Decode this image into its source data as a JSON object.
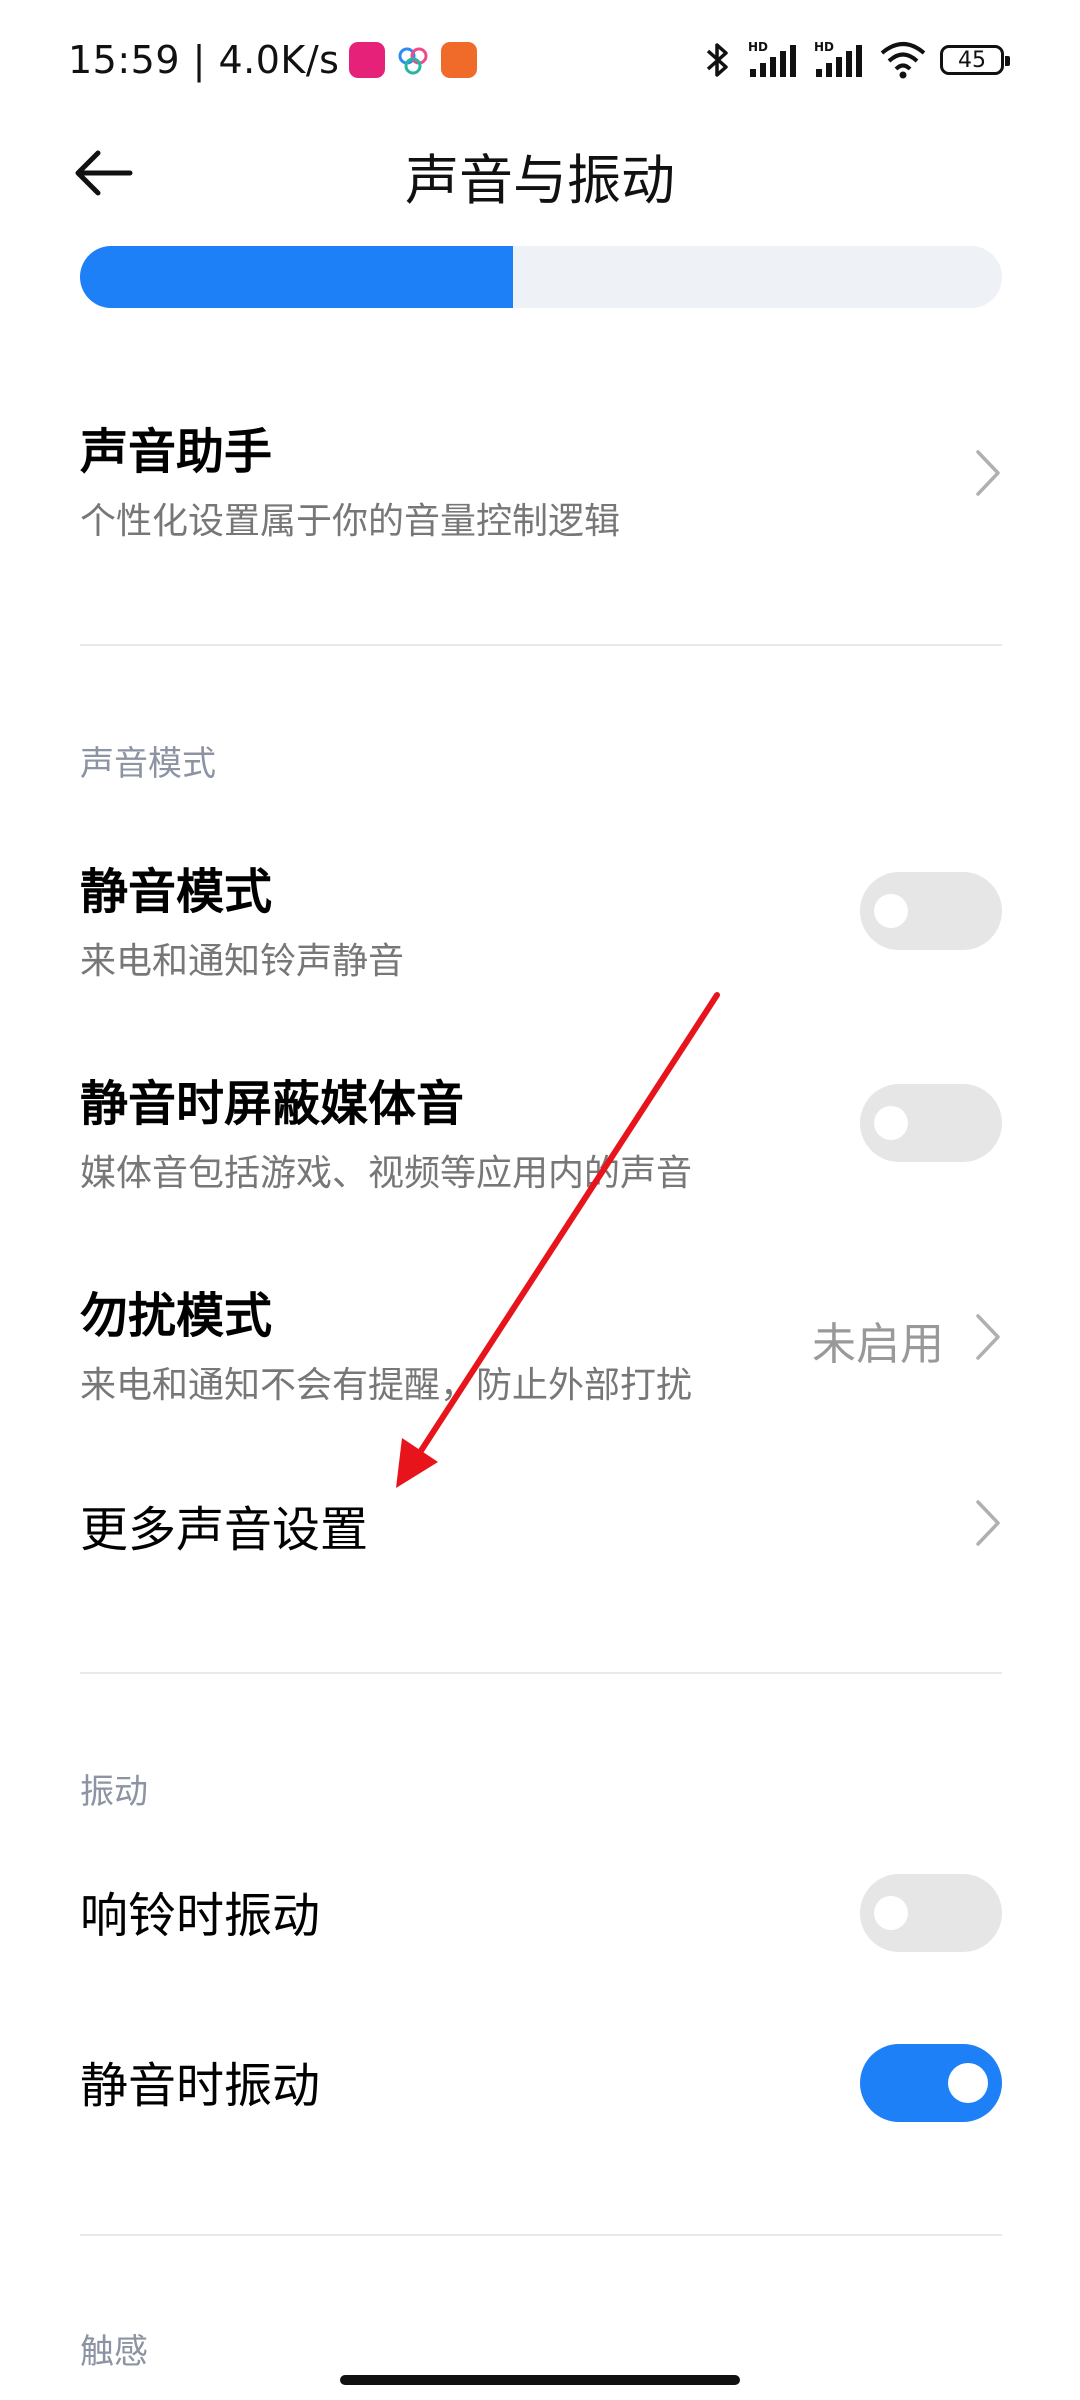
{
  "status_bar": {
    "time": "15:59",
    "network_speed": "4.0K/s",
    "battery": "45",
    "icons": [
      "bluetooth-icon",
      "signal-hd-icon",
      "signal-hd-icon",
      "wifi-icon",
      "battery-icon"
    ]
  },
  "header": {
    "title": "声音与振动",
    "back_icon": "back-arrow-icon"
  },
  "volume_slider": {
    "level": 0.47,
    "fill_color": "#1d80f7",
    "track_color": "#eef1f5"
  },
  "items": {
    "sound_assistant": {
      "title": "声音助手",
      "subtitle": "个性化设置属于你的音量控制逻辑"
    },
    "silent_mode": {
      "title": "静音模式",
      "subtitle": "来电和通知铃声静音",
      "enabled": false
    },
    "mute_media": {
      "title": "静音时屏蔽媒体音",
      "subtitle": "媒体音包括游戏、视频等应用内的声音",
      "enabled": false
    },
    "dnd": {
      "title": "勿扰模式",
      "subtitle": "来电和通知不会有提醒，防止外部打扰",
      "value": "未启用"
    },
    "more_sound": {
      "title": "更多声音设置"
    },
    "vibrate_ring": {
      "title": "响铃时振动",
      "enabled": false
    },
    "vibrate_silent": {
      "title": "静音时振动",
      "enabled": true
    }
  },
  "sections": {
    "sound_mode": "声音模式",
    "vibration": "振动",
    "haptics": "触感"
  },
  "colors": {
    "accent": "#1d80f7",
    "annotation_arrow": "#e8141b"
  }
}
